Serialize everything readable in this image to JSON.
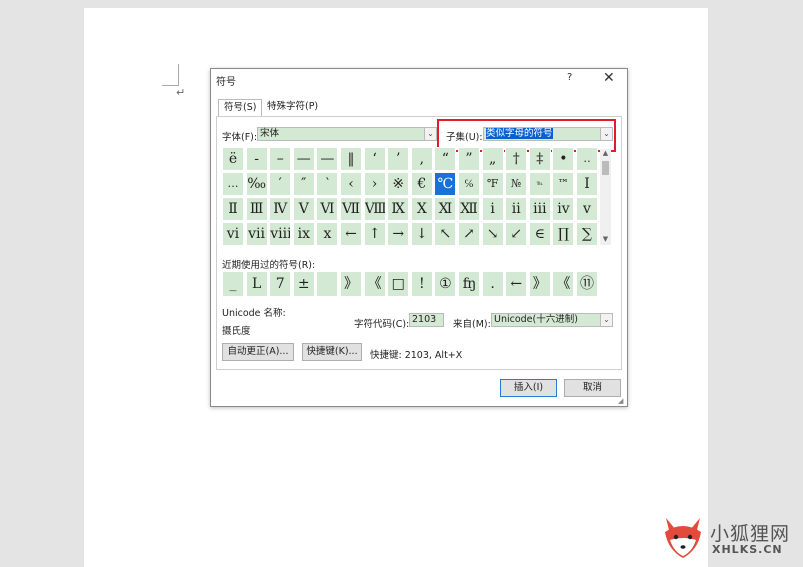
{
  "dialog": {
    "title": "符号",
    "help": "?",
    "close": "✕",
    "tabs": [
      {
        "label": "符号(S)"
      },
      {
        "label": "特殊字符(P)"
      }
    ],
    "font_label": "字体(F):",
    "font_value": "宋体",
    "subset_label": "子集(U):",
    "subset_value": "类似字母的符号",
    "symbols": [
      [
        "ë",
        "-",
        "–",
        "—",
        "—",
        "‖",
        "‘",
        "’",
        ",",
        "“",
        "”",
        "„",
        "†",
        "‡",
        "•",
        "‥"
      ],
      [
        "…",
        "‰",
        "′",
        "″",
        "‵",
        "‹",
        "›",
        "※",
        "€",
        "℃",
        "℅",
        "℉",
        "№",
        "℡",
        "™",
        "Ⅰ"
      ],
      [
        "Ⅱ",
        "Ⅲ",
        "Ⅳ",
        "Ⅴ",
        "Ⅵ",
        "Ⅶ",
        "Ⅷ",
        "Ⅸ",
        "Ⅹ",
        "Ⅺ",
        "Ⅻ",
        "ⅰ",
        "ⅱ",
        "ⅲ",
        "ⅳ",
        "ⅴ"
      ],
      [
        "ⅵ",
        "ⅶ",
        "ⅷ",
        "ⅸ",
        "ⅹ",
        "←",
        "↑",
        "→",
        "↓",
        "↖",
        "↗",
        "↘",
        "↙",
        "∈",
        "∏",
        "∑"
      ]
    ],
    "recent_label": "近期使用过的符号(R):",
    "recent": [
      "_",
      "L",
      "7",
      "±",
      "",
      "》",
      "《",
      "□",
      "!",
      "①",
      "ʩ",
      ".",
      "←",
      "》",
      "《",
      "⑪"
    ],
    "unicode_name_label": "Unicode 名称:",
    "unicode_name_value": "摄氏度",
    "char_code_label": "字符代码(C):",
    "char_code_value": "2103",
    "from_label": "来自(M):",
    "from_value": "Unicode(十六进制)",
    "autocorrect_button": "自动更正(A)...",
    "shortcut_button": "快捷键(K)...",
    "shortcut_text": "快捷键: 2103, Alt+X",
    "insert_button": "插入(I)",
    "cancel_button": "取消"
  },
  "watermark": {
    "text_cn": "小狐狸网",
    "text_en": "XHLKS.CN"
  },
  "colors": {
    "cell_bg": "#d4e9d4",
    "selected": "#1970d6",
    "highlight_border": "#e21d2b"
  }
}
